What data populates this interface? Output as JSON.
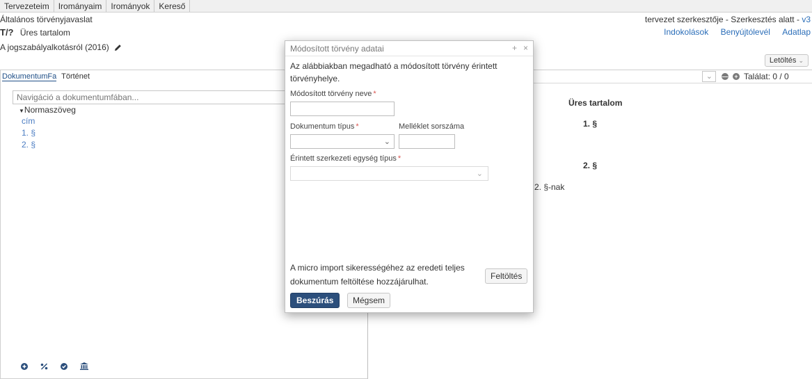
{
  "topnav": {
    "tabs": [
      "Tervezeteim",
      "Irományaim",
      "Irományok",
      "Kereső"
    ]
  },
  "header": {
    "doc_type": "Általános törvényjavaslat",
    "doc_code": "T/?",
    "doc_subtitle": "Üres tartalom",
    "doc_title": "A jogszabályalkotásról (2016)",
    "status": "tervezet szerkesztője - Szerkesztés alatt - ",
    "version": "v3",
    "links": [
      "Indokolások",
      "Benyújtólevél",
      "Adatlap"
    ],
    "download_label": "Letöltés"
  },
  "left_panel": {
    "tabs": [
      "DokumentumFa",
      "Történet"
    ],
    "search_placeholder": "Navigáció a dokumentumfában...",
    "tree_root": "Normaszöveg",
    "tree_items": [
      "cím",
      "1. §",
      "2. §"
    ],
    "footer_icons": [
      "plus-circle-icon",
      "percent-icon",
      "check-circle-icon",
      "bank-icon"
    ]
  },
  "right_panel": {
    "match_label": "Találat: 0 / 0",
    "content_title": "Üres tartalom",
    "section_1": "1. §",
    "section_2": "2. §",
    "ref_text": "2. §-nak"
  },
  "modal": {
    "title": "Módosított törvény adatai",
    "ctrl_add": "+",
    "ctrl_close": "×",
    "intro_line1": "Az alábbiakban megadható a módosított törvény érintett",
    "intro_line2": "törvényhelye.",
    "name_label": "Módosított törvény neve",
    "doc_type_label": "Dokumentum típus",
    "attachment_label": "Melléklet sorszáma",
    "unit_type_label": "Érintett szerkezeti egység típus",
    "required_mark": "*",
    "hint_line1": "A micro import sikerességéhez az eredeti teljes",
    "hint_line2": "dokumentum feltöltése hozzájárulhat.",
    "upload_label": "Feltöltés",
    "insert_label": "Beszúrás",
    "cancel_label": "Mégsem"
  }
}
